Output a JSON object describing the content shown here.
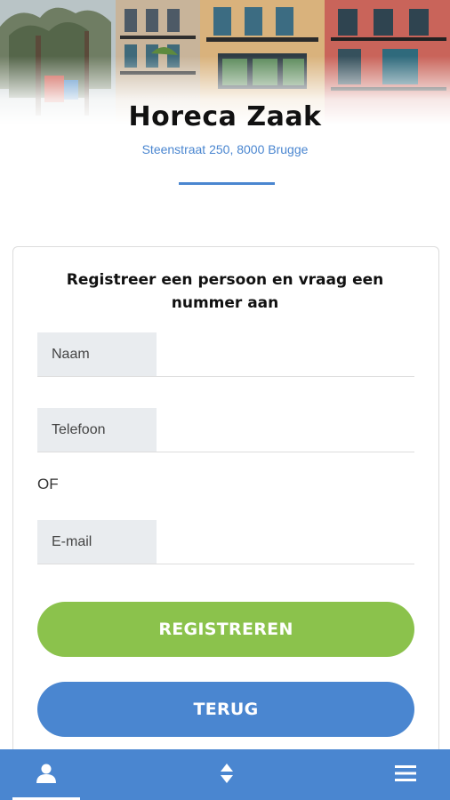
{
  "business": {
    "name": "Horeca Zaak",
    "address": "Steenstraat 250, 8000 Brugge"
  },
  "form": {
    "title": "Registreer een persoon en vraag een nummer aan",
    "fields": {
      "name_label": "Naam",
      "name_value": "",
      "phone_label": "Telefoon",
      "phone_value": "",
      "email_label": "E-mail",
      "email_value": ""
    },
    "or_text": "OF",
    "register_label": "REGISTREREN",
    "back_label": "TERUG"
  },
  "bottom_nav": {
    "items": [
      {
        "icon": "person-icon",
        "active": true
      },
      {
        "icon": "sort-icon",
        "active": false
      },
      {
        "icon": "hamburger-menu-icon",
        "active": false
      }
    ]
  },
  "colors": {
    "accent_blue": "#4a86d0",
    "register_green": "#8bc24c",
    "field_label_bg": "#e9ecef"
  }
}
